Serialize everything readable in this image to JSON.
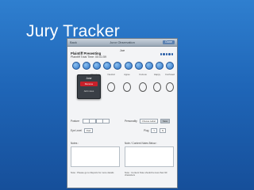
{
  "slide": {
    "title": "Jury Tracker"
  },
  "app": {
    "titlebar": {
      "left": "Back",
      "center": "Juror Observation",
      "right": "Done"
    },
    "juror_name": "Joe",
    "heading": "Plaintiff Presenting",
    "subheading": "Plaintiff Total Time: 00:01:59",
    "face_labels": [
      "Bored",
      "Disagree",
      "Neutral",
      "Agree",
      "Curious",
      "Happy",
      "Confused"
    ],
    "popup": {
      "title": "Juror",
      "red_button": "Remove",
      "option": "Add notes"
    },
    "rows": {
      "posture_label": "Posture",
      "eye_contact_label": "Eye Level",
      "eye_contact_value": "Fwd",
      "personality_label": "Personality",
      "personality_value": "Choose Label",
      "personality_btn": "Save",
      "plug_label": "Plug",
      "plug_options": [
        "Y",
        "N"
      ]
    },
    "notes": {
      "left_label": "Notes :",
      "right_label": "Note / Content Notes Below :"
    },
    "hints": {
      "left": "Note : Please go to Reports for more details",
      "right": "Note : Content Note should be less than 90 characters"
    },
    "colors": {
      "background": "#1f66b8",
      "accent": "#2e74c8",
      "alert": "#c8202a"
    }
  }
}
